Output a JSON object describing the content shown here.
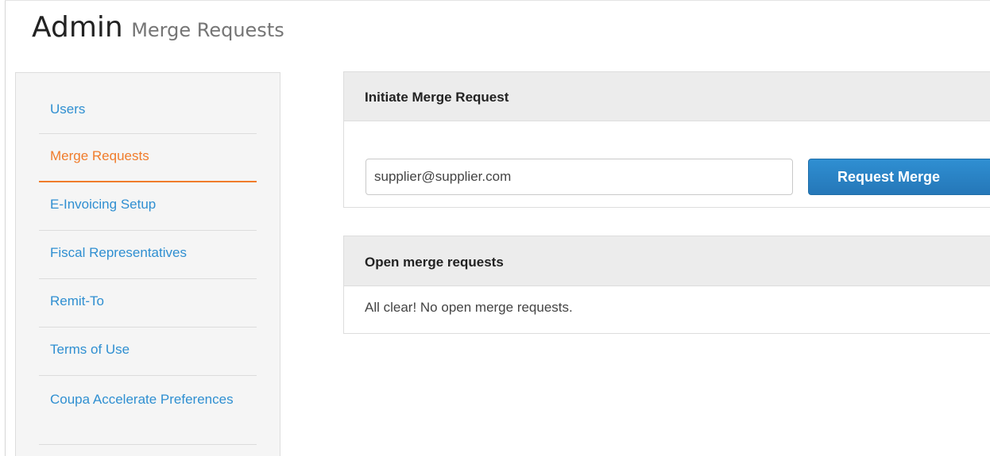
{
  "header": {
    "title": "Admin",
    "subtitle": "Merge Requests"
  },
  "sidebar": {
    "items": [
      {
        "label": "Users",
        "active": false
      },
      {
        "label": "Merge Requests",
        "active": true
      },
      {
        "label": "E-Invoicing Setup",
        "active": false
      },
      {
        "label": "Fiscal Representatives",
        "active": false
      },
      {
        "label": "Remit-To",
        "active": false
      },
      {
        "label": "Terms of Use",
        "active": false
      },
      {
        "label": "Coupa Accelerate Preferences",
        "active": false
      }
    ]
  },
  "initiate": {
    "title": "Initiate Merge Request",
    "email_value": "supplier@supplier.com",
    "button_label": "Request Merge"
  },
  "open_requests": {
    "title": "Open merge requests",
    "empty_message": "All clear! No open merge requests."
  },
  "colors": {
    "link": "#2f8fd1",
    "active": "#f07c2b",
    "primary_button": "#2577b8"
  }
}
